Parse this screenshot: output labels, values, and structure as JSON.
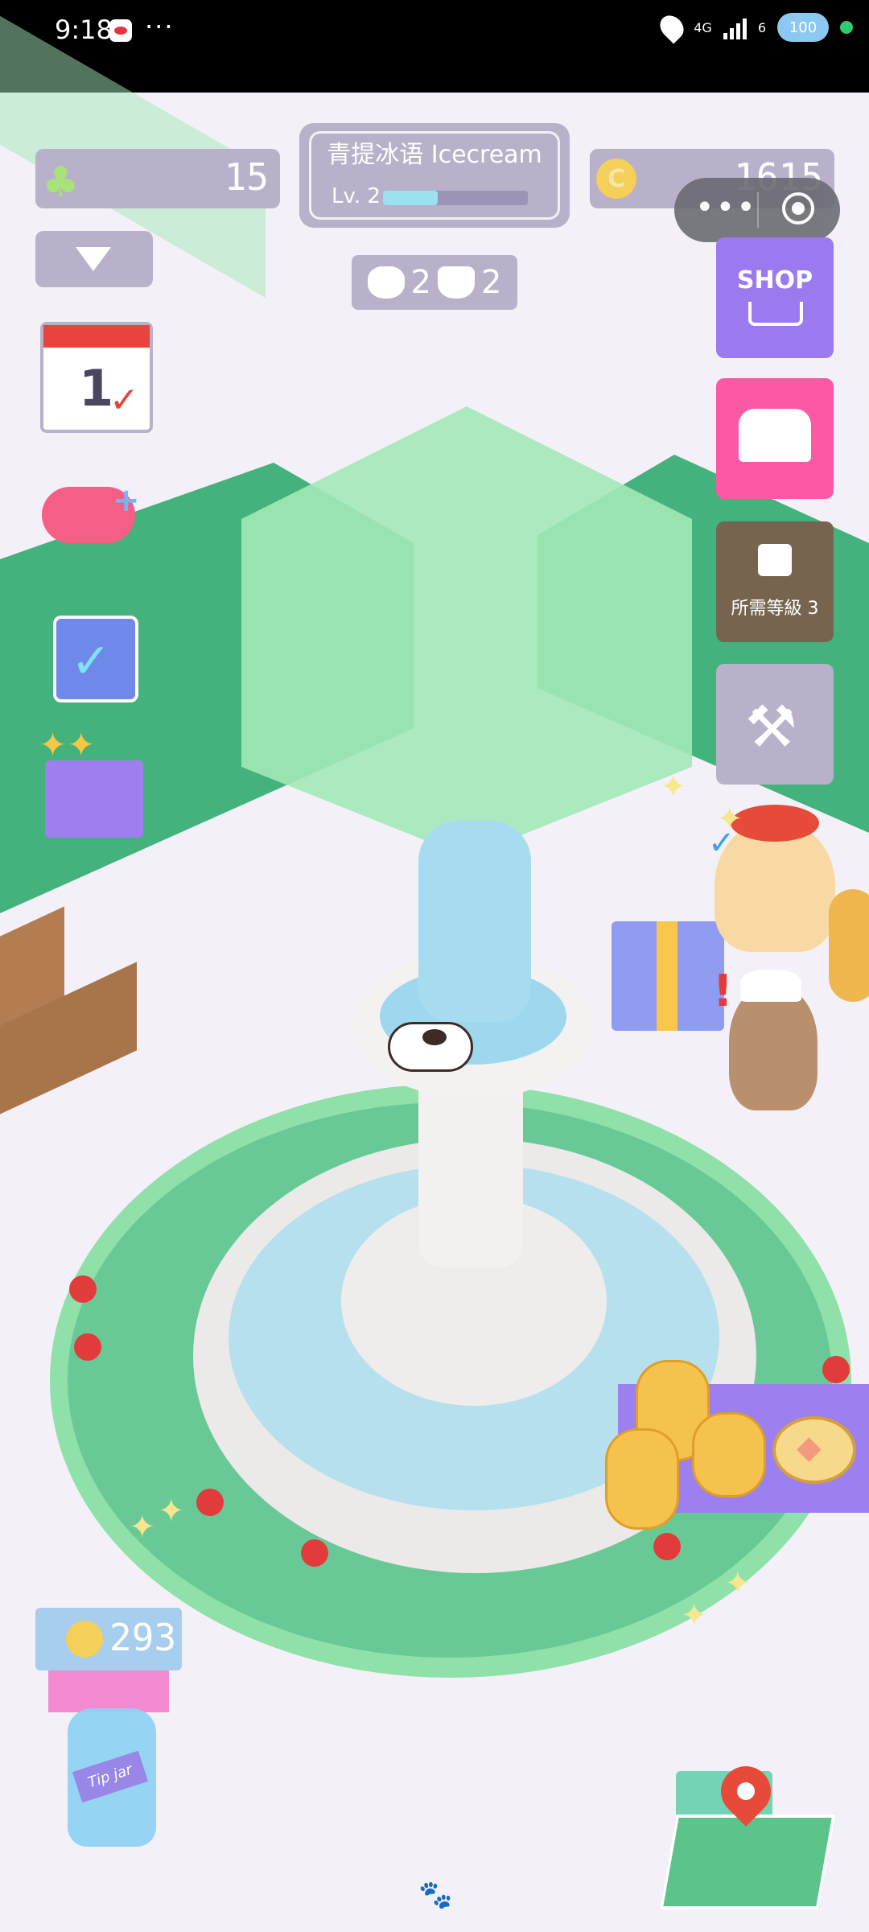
{
  "status_bar": {
    "time": "9:18",
    "more": "···",
    "network": "4G",
    "wifi_sub": "6",
    "battery": "100"
  },
  "hud": {
    "clovers": "15",
    "coins": "1615",
    "cafe_name": "青提冰语 Icecream",
    "level": "Lv. 2",
    "xp_fraction": 0.38,
    "dogs": "2",
    "cats": "2"
  },
  "mini_program": {
    "menu": "•••"
  },
  "side_buttons": {
    "shop_label": "SHOP",
    "locked_label": "所需等級 3"
  },
  "calendar": {
    "day": "1",
    "check": "✓"
  },
  "gamepad_plus": "+",
  "checklist_tick": "✓",
  "tip_jar": {
    "amount": "293",
    "label": "Tip jar"
  },
  "icons": {
    "clover": "clover-icon",
    "coin": "coin-icon",
    "tools": "⚒",
    "coin_symbol": "C"
  },
  "colors": {
    "hud": "#b9b1ca",
    "shop": "#9b7af0",
    "chest": "#fb59a6",
    "locked": "#76644f",
    "hedge": "#44b27c",
    "lawn": "#a3e8b7",
    "water": "#b7e0ee"
  }
}
